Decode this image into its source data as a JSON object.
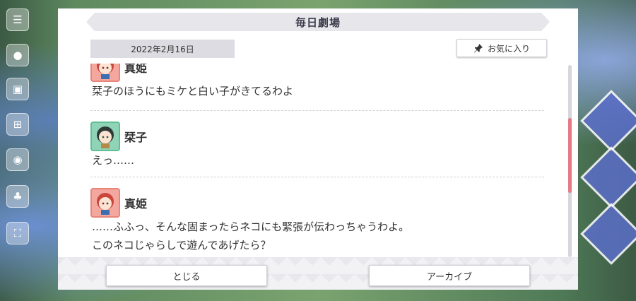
{
  "modal": {
    "title": "毎日劇場",
    "date": "2022年2月16日",
    "favorite_label": "お気に入り",
    "entries": [
      {
        "speaker": "真姫",
        "avatar": "maki-portrait-icon",
        "lines": [
          "栞子のほうにもミケと白い子がきてるわよ"
        ]
      },
      {
        "speaker": "栞子",
        "avatar": "shioriko-portrait-icon",
        "lines": [
          "えっ……"
        ]
      },
      {
        "speaker": "真姫",
        "avatar": "maki-portrait-icon",
        "lines": [
          "……ふふっ、そんな固まったらネコにも緊張が伝わっちゃうわよ。",
          "このネコじゃらしで遊んであげたら？"
        ]
      }
    ],
    "scroll_position": 0.45,
    "close_label": "とじる",
    "archive_label": "アーカイブ"
  },
  "colors": {
    "scroll_thumb": "#e57b86",
    "maki_frame": "#e8847a",
    "shioriko_frame": "#5fbf97"
  }
}
